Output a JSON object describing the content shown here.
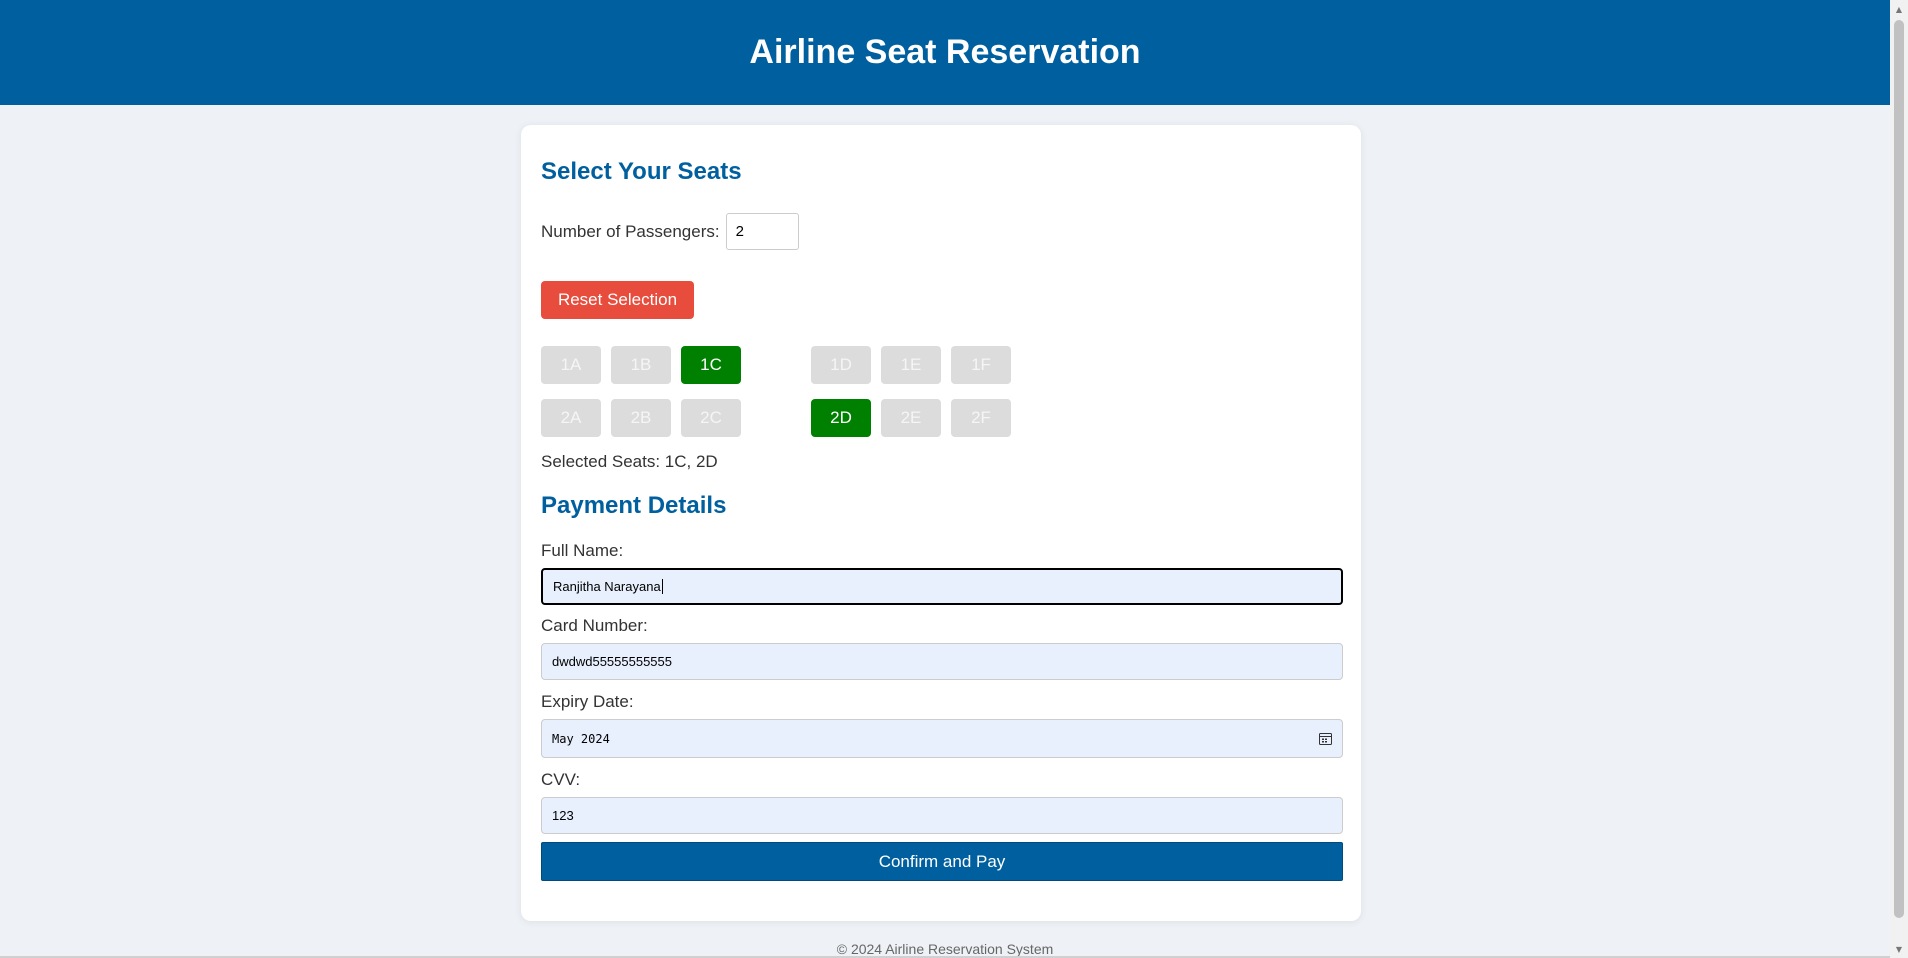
{
  "header": {
    "title": "Airline Seat Reservation"
  },
  "seats_section": {
    "heading": "Select Your Seats",
    "passengers_label": "Number of Passengers:",
    "passengers_value": "2",
    "reset_label": "Reset Selection",
    "rows": [
      [
        "1A",
        "1B",
        "1C",
        "1D",
        "1E",
        "1F"
      ],
      [
        "2A",
        "2B",
        "2C",
        "2D",
        "2E",
        "2F"
      ]
    ],
    "selected_seats": [
      "1C",
      "2D"
    ],
    "selected_text": "Selected Seats: 1C, 2D"
  },
  "payment": {
    "heading": "Payment Details",
    "full_name_label": "Full Name:",
    "full_name_value": "Ranjitha Narayana",
    "card_label": "Card Number:",
    "card_value": "dwdwd55555555555",
    "expiry_label": "Expiry Date:",
    "expiry_value": "May 2024",
    "cvv_label": "CVV:",
    "cvv_value": "123",
    "confirm_label": "Confirm and Pay"
  },
  "footer": {
    "text": "© 2024 Airline Reservation System"
  },
  "colors": {
    "primary": "#005f9e",
    "reset": "#e74c3c",
    "selected_seat": "#008000",
    "unavailable_seat": "#dcdcdc"
  }
}
